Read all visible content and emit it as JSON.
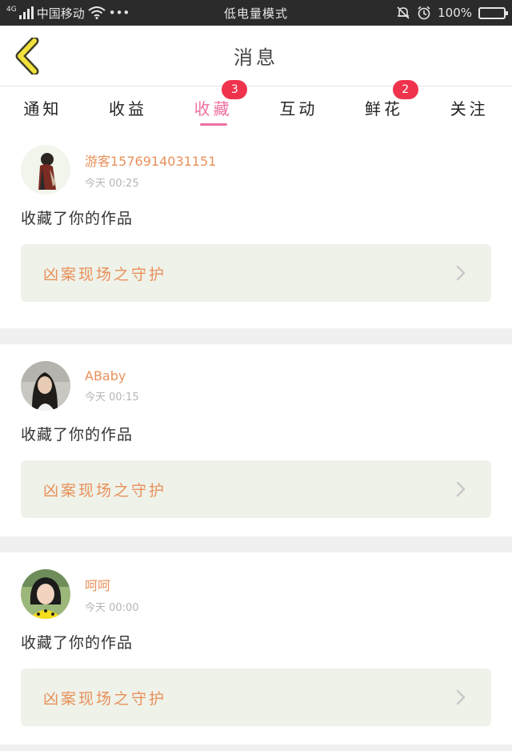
{
  "status_bar": {
    "network": "4G",
    "carrier": "中国移动",
    "more": "•••",
    "mode": "低电量模式",
    "battery": "100%"
  },
  "header": {
    "title": "消息",
    "back_icon": "chevron-left-icon"
  },
  "tabs": [
    {
      "label": "通知",
      "active": false,
      "badge": ""
    },
    {
      "label": "收益",
      "active": false,
      "badge": ""
    },
    {
      "label": "收藏",
      "active": true,
      "badge": "3"
    },
    {
      "label": "互动",
      "active": false,
      "badge": ""
    },
    {
      "label": "鲜花",
      "active": false,
      "badge": "2"
    },
    {
      "label": "关注",
      "active": false,
      "badge": ""
    }
  ],
  "messages": [
    {
      "username": "游客1576914031151",
      "time": "今天 00:25",
      "action": "收藏了你的作品",
      "work": "凶案现场之守护"
    },
    {
      "username": "ABaby",
      "time": "今天 00:15",
      "action": "收藏了你的作品",
      "work": "凶案现场之守护"
    },
    {
      "username": "呵呵",
      "time": "今天 00:00",
      "action": "收藏了你的作品",
      "work": "凶案现场之守护"
    }
  ],
  "colors": {
    "accent_pink": "#ef6fa1",
    "badge_red": "#f0334d",
    "username_orange": "#e8905a",
    "work_bg": "#eff2e9",
    "back_yellow": "#f2e13b"
  }
}
